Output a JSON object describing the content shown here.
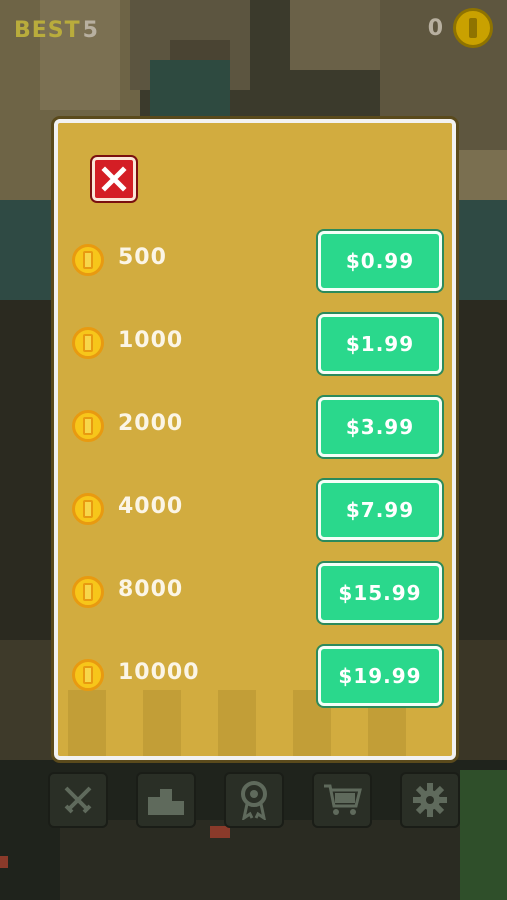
{
  "hud": {
    "best_label": "BEST",
    "best_value": "5",
    "coins": "0",
    "coin_icon": "coin-icon"
  },
  "shop": {
    "close_icon": "close-x-icon",
    "items": [
      {
        "amount": "500",
        "price": "$0.99"
      },
      {
        "amount": "1000",
        "price": "$1.99"
      },
      {
        "amount": "2000",
        "price": "$3.99"
      },
      {
        "amount": "4000",
        "price": "$7.99"
      },
      {
        "amount": "8000",
        "price": "$15.99"
      },
      {
        "amount": "10000",
        "price": "$19.99"
      }
    ]
  },
  "toolbar": {
    "buttons": [
      {
        "icon": "crossed-swords-icon"
      },
      {
        "icon": "podium-icon"
      },
      {
        "icon": "award-ribbon-icon"
      },
      {
        "icon": "shopping-cart-icon"
      },
      {
        "icon": "gear-icon"
      }
    ]
  },
  "colors": {
    "panel": "#d2ac3f",
    "price_button": "#2ad88c",
    "close_button": "#d41e25",
    "coin": "#f7c61a"
  }
}
